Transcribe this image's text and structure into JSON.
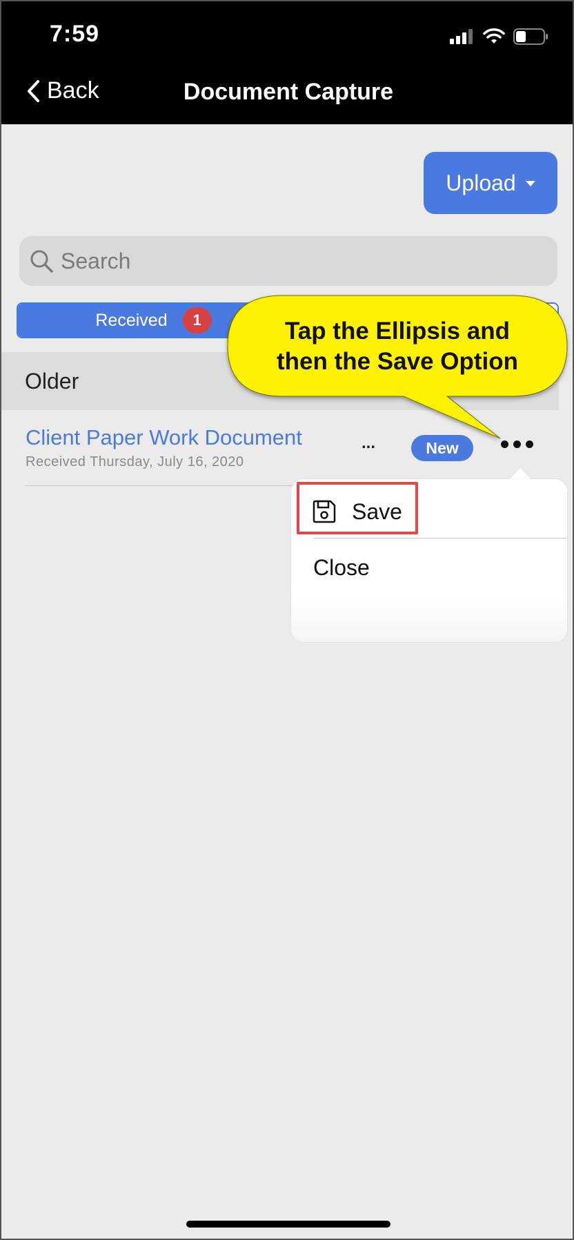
{
  "status_bar": {
    "time": "7:59"
  },
  "nav": {
    "back_label": "Back",
    "title": "Document Capture"
  },
  "toolbar": {
    "upload_label": "Upload"
  },
  "search": {
    "placeholder": "Search"
  },
  "segment": {
    "received_label": "Received",
    "received_count": "1"
  },
  "section": {
    "header": "Older"
  },
  "document": {
    "title": "Client Paper Work Document",
    "subtitle": "Received Thursday, July 16, 2020",
    "status_badge": "New",
    "inline_ellipsis": "..."
  },
  "menu": {
    "save_label": "Save",
    "close_label": "Close"
  },
  "callout": {
    "text": "Tap the Ellipsis and\nthen the Save Option"
  },
  "colors": {
    "accent": "#4a7ae0",
    "badge_red": "#d94040",
    "callout_yellow": "#fff200",
    "highlight_red": "#e24a4a",
    "background": "#ebebeb"
  }
}
